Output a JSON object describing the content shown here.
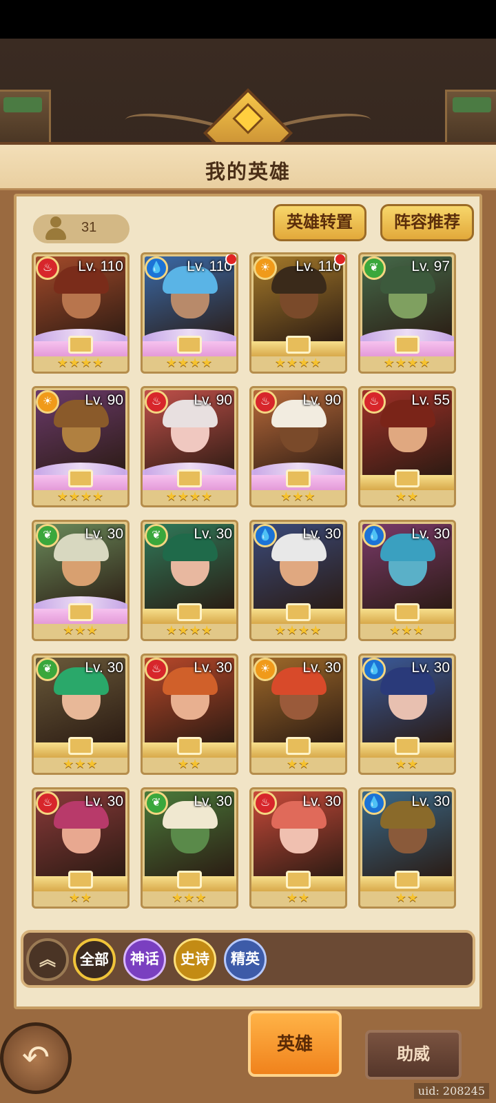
{
  "header": {
    "title": "我的英雄"
  },
  "toolbar": {
    "hero_count": "31",
    "transfer_label": "英雄转置",
    "lineup_label": "阵容推荐"
  },
  "heroes": [
    {
      "level": "Lv. 110",
      "element": "fire",
      "rarity": "mythic",
      "stars": "★★★★",
      "red_dot": false,
      "art": "#a34a2a",
      "hair": "#7a2c1a",
      "skin": "#b8754d"
    },
    {
      "level": "Lv. 110",
      "element": "water",
      "rarity": "mythic",
      "stars": "★★★★",
      "red_dot": true,
      "art": "#3a6aa8",
      "hair": "#5ab4e6",
      "skin": "#b88a6a"
    },
    {
      "level": "Lv. 110",
      "element": "light",
      "rarity": "epic",
      "stars": "★★★★",
      "red_dot": true,
      "art": "#a57a2a",
      "hair": "#3a2a1a",
      "skin": "#7a4a2a"
    },
    {
      "level": "Lv. 97",
      "element": "nature",
      "rarity": "mythic",
      "stars": "★★★★",
      "red_dot": false,
      "art": "#456a4a",
      "hair": "#3c5a3c",
      "skin": "#7fa060"
    },
    {
      "level": "Lv. 90",
      "element": "light",
      "rarity": "mythic",
      "stars": "★★★★",
      "red_dot": false,
      "art": "#6a3a6a",
      "hair": "#8a5a2a",
      "skin": "#b08040"
    },
    {
      "level": "Lv. 90",
      "element": "fire",
      "rarity": "mythic",
      "stars": "★★★★",
      "red_dot": false,
      "art": "#c0504a",
      "hair": "#e8e0e0",
      "skin": "#f0c8c0"
    },
    {
      "level": "Lv. 90",
      "element": "fire",
      "rarity": "mythic",
      "stars": "★★★",
      "red_dot": false,
      "art": "#b86a3a",
      "hair": "#f2ece0",
      "skin": "#7a4a2a"
    },
    {
      "level": "Lv. 55",
      "element": "fire",
      "rarity": "epic",
      "stars": "★★",
      "red_dot": false,
      "art": "#a03028",
      "hair": "#7a2418",
      "skin": "#e0a880"
    },
    {
      "level": "Lv. 30",
      "element": "nature",
      "rarity": "mythic",
      "stars": "★★★",
      "red_dot": false,
      "art": "#6a8a5a",
      "hair": "#d8d8c0",
      "skin": "#d8a070"
    },
    {
      "level": "Lv. 30",
      "element": "nature",
      "rarity": "epic",
      "stars": "★★★★",
      "red_dot": false,
      "art": "#2f7a5a",
      "hair": "#1f6a4a",
      "skin": "#e8b8a0"
    },
    {
      "level": "Lv. 30",
      "element": "water",
      "rarity": "epic",
      "stars": "★★★★",
      "red_dot": false,
      "art": "#3a4a7a",
      "hair": "#e8e8e8",
      "skin": "#e0a880"
    },
    {
      "level": "Lv. 30",
      "element": "water",
      "rarity": "epic",
      "stars": "★★★",
      "red_dot": false,
      "art": "#7a3a6a",
      "hair": "#3aa0c0",
      "skin": "#5ab0c8"
    },
    {
      "level": "Lv. 30",
      "element": "nature",
      "rarity": "epic",
      "stars": "★★★",
      "red_dot": false,
      "art": "#6a5a3a",
      "hair": "#2aa86a",
      "skin": "#e8b898"
    },
    {
      "level": "Lv. 30",
      "element": "fire",
      "rarity": "epic",
      "stars": "★★",
      "red_dot": false,
      "art": "#b8482a",
      "hair": "#d0602a",
      "skin": "#e8b090"
    },
    {
      "level": "Lv. 30",
      "element": "light",
      "rarity": "epic",
      "stars": "★★",
      "red_dot": false,
      "art": "#a06a2a",
      "hair": "#d84a2a",
      "skin": "#9a5a3a"
    },
    {
      "level": "Lv. 30",
      "element": "water",
      "rarity": "epic",
      "stars": "★★",
      "red_dot": false,
      "art": "#3a5a9a",
      "hair": "#2a3a7a",
      "skin": "#e8c0b0"
    },
    {
      "level": "Lv. 30",
      "element": "fire",
      "rarity": "epic",
      "stars": "★★",
      "red_dot": false,
      "art": "#8a3a3a",
      "hair": "#b83a6a",
      "skin": "#e8a890"
    },
    {
      "level": "Lv. 30",
      "element": "nature",
      "rarity": "epic",
      "stars": "★★★",
      "red_dot": false,
      "art": "#4a7a3a",
      "hair": "#f0e8d0",
      "skin": "#5a8a4a"
    },
    {
      "level": "Lv. 30",
      "element": "fire",
      "rarity": "epic",
      "stars": "★★",
      "red_dot": false,
      "art": "#c84a3a",
      "hair": "#e06a5a",
      "skin": "#f0c0b0"
    },
    {
      "level": "Lv. 30",
      "element": "water",
      "rarity": "epic",
      "stars": "★★",
      "red_dot": false,
      "art": "#3a6a8a",
      "hair": "#8a6a2a",
      "skin": "#8a5a3a"
    }
  ],
  "filters": {
    "collapse_icon": "chevron-double-up-icon",
    "collapse": "︽",
    "all": "全部",
    "mythic": "神话",
    "epic": "史诗",
    "elite": "精英"
  },
  "nav": {
    "back_icon": "back-arrow-icon",
    "back": "↶",
    "heroes_tab": "英雄",
    "support_tab": "助威"
  },
  "footer": {
    "uid": "uid: 208245"
  },
  "colors": {
    "accent": "#f0821c",
    "panel": "#f1e4c6",
    "gold": "#f6c22e"
  }
}
